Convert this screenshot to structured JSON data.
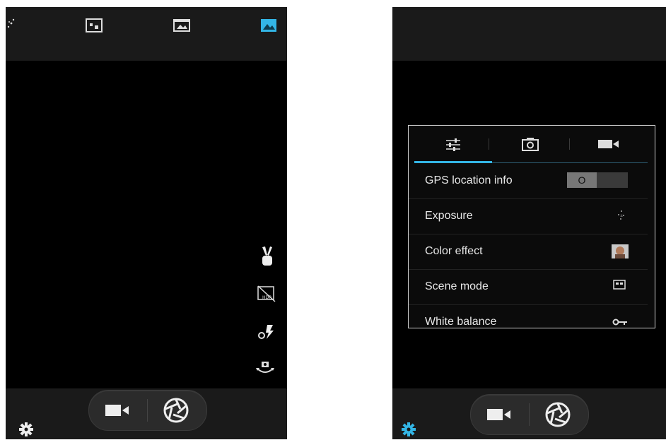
{
  "left_screen": {
    "top_modes": [
      "sparkle-icon",
      "panorama-small-icon",
      "filmstrip-icon",
      "photo-mode-icon"
    ],
    "side_controls": [
      "peace-gesture-icon",
      "hdr-off-icon",
      "flash-auto-icon",
      "camera-switch-icon"
    ],
    "bottom": {
      "settings": "gear-icon",
      "video": "video-camera-icon",
      "shutter": "shutter-aperture-icon"
    }
  },
  "right_screen": {
    "settings_panel": {
      "tabs": [
        {
          "icon": "sliders-icon",
          "selected": true
        },
        {
          "icon": "camera-icon",
          "selected": false
        },
        {
          "icon": "video-camera-icon",
          "selected": false
        }
      ],
      "rows": [
        {
          "label": "GPS location info",
          "control": "toggle",
          "value": "O"
        },
        {
          "label": "Exposure",
          "control": "exposure-icon"
        },
        {
          "label": "Color effect",
          "control": "color-effect-icon"
        },
        {
          "label": "Scene mode",
          "control": "scene-mode-icon"
        },
        {
          "label": "White balance",
          "control": "white-balance-icon"
        }
      ]
    },
    "bottom": {
      "settings": "gear-icon",
      "video": "video-camera-icon",
      "shutter": "shutter-aperture-icon"
    }
  },
  "colors": {
    "accent": "#33b5e5",
    "bar": "#1a1a1a",
    "viewfinder": "#000000",
    "panel_border": "#cfcfcf"
  }
}
